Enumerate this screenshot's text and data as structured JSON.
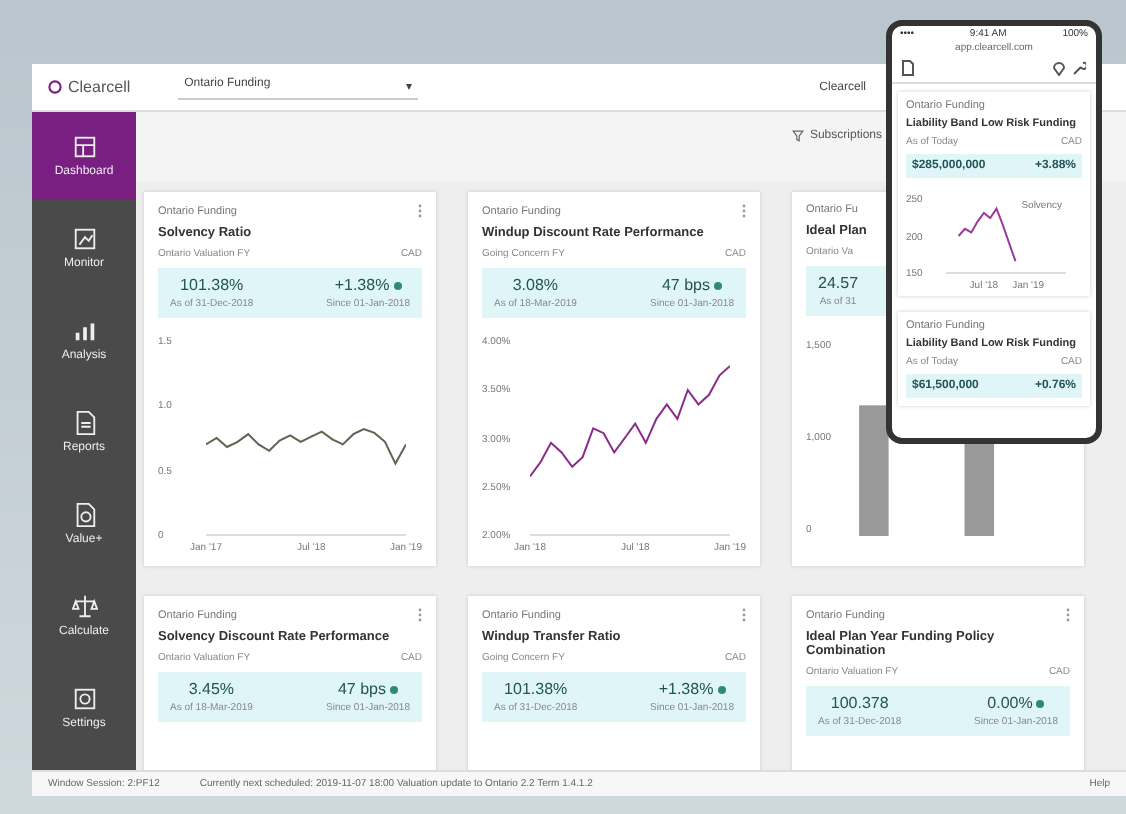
{
  "app": {
    "logo": "Clearcell",
    "plan_selector": "Ontario Funding",
    "caret": "▾",
    "account": "Clearcell"
  },
  "toolbar": {
    "subscriptions": "Subscriptions"
  },
  "sidebar": [
    {
      "label": "Dashboard",
      "selected": true
    },
    {
      "label": "Monitor",
      "selected": false
    },
    {
      "label": "Analysis",
      "selected": false
    },
    {
      "label": "Reports",
      "selected": false
    },
    {
      "label": "Value+",
      "selected": false
    },
    {
      "label": "Calculate",
      "selected": false
    },
    {
      "label": "Settings",
      "selected": false
    }
  ],
  "cards": [
    {
      "kind": "line",
      "category": "Ontario Funding",
      "title": "Solvency Ratio",
      "basis": "Ontario Valuation FY",
      "currency": "CAD",
      "metrics": [
        {
          "value": "101.38%",
          "caption": "As of 31-Dec-2018",
          "indicator": false
        },
        {
          "value": "+1.38%",
          "caption": "Since 01-Jan-2018",
          "indicator": true
        }
      ],
      "chart_data": {
        "type": "line",
        "categories": [
          "Jan '17",
          null,
          null,
          null,
          null,
          null,
          null,
          null,
          null,
          null,
          "Jul '18",
          null,
          null,
          null,
          null,
          null,
          null,
          null,
          null,
          "Jan '19"
        ],
        "ylim": [
          0,
          1.5
        ],
        "yticks": [
          {
            "value": 0,
            "label": "0"
          },
          {
            "value": 0.5,
            "label": "0.5"
          },
          {
            "value": 1,
            "label": "1.0"
          },
          {
            "value": 1.5,
            "label": "1.5"
          }
        ],
        "series": [
          {
            "color": "#5b6650",
            "values": [
              0.7,
              0.75,
              0.68,
              0.72,
              0.78,
              0.7,
              0.65,
              0.73,
              0.77,
              0.72,
              0.76,
              0.8,
              0.74,
              0.7,
              0.78,
              0.82,
              0.79,
              0.72,
              0.55,
              0.7
            ]
          }
        ]
      }
    },
    {
      "kind": "line",
      "category": "Ontario Funding",
      "title": "Windup Discount Rate Performance",
      "basis": "Going Concern FY",
      "currency": "CAD",
      "metrics": [
        {
          "value": "3.08%",
          "caption": "As of 18-Mar-2019",
          "indicator": false
        },
        {
          "value": "47 bps",
          "caption": "Since 01-Jan-2018",
          "indicator": true
        }
      ],
      "chart_data": {
        "type": "line",
        "categories": [
          "Jan '18",
          null,
          null,
          null,
          null,
          null,
          null,
          null,
          null,
          null,
          "Jul '18",
          null,
          null,
          null,
          null,
          null,
          null,
          null,
          null,
          "Jan '19"
        ],
        "ylim": [
          2,
          4
        ],
        "yticks": [
          {
            "value": 2,
            "label": "2.00%"
          },
          {
            "value": 2.5,
            "label": "2.50%"
          },
          {
            "value": 3,
            "label": "3.00%"
          },
          {
            "value": 3.5,
            "label": "3.50%"
          },
          {
            "value": 4,
            "label": "4.00%"
          }
        ],
        "series": [
          {
            "color": "#8a2b8a",
            "values": [
              2.6,
              2.75,
              2.95,
              2.85,
              2.7,
              2.8,
              3.1,
              3.05,
              2.85,
              3.0,
              3.15,
              2.95,
              3.2,
              3.35,
              3.2,
              3.5,
              3.35,
              3.45,
              3.65,
              3.75
            ]
          }
        ]
      }
    },
    {
      "kind": "bars",
      "category": "Ontario Fu",
      "title": "Ideal Plan",
      "basis": "Ontario Va",
      "metrics": [
        {
          "value": "24.57",
          "caption": "As of 31",
          "indicator": false
        }
      ],
      "y_ticks": [
        "1,500",
        "1,000",
        "0"
      ]
    },
    {
      "kind": "summary",
      "category": "Ontario Funding",
      "title": "Solvency Discount Rate Performance",
      "basis": "Ontario Valuation FY",
      "currency": "CAD",
      "metrics": [
        {
          "value": "3.45%",
          "caption": "As of 18-Mar-2019",
          "indicator": false
        },
        {
          "value": "47 bps",
          "caption": "Since 01-Jan-2018",
          "indicator": true
        }
      ]
    },
    {
      "kind": "summary",
      "category": "Ontario Funding",
      "title": "Windup Transfer Ratio",
      "basis": "Going Concern FY",
      "currency": "CAD",
      "metrics": [
        {
          "value": "101.38%",
          "caption": "As of 31-Dec-2018",
          "indicator": false
        },
        {
          "value": "+1.38%",
          "caption": "Since 01-Jan-2018",
          "indicator": true
        }
      ]
    },
    {
      "kind": "summary",
      "category": "Ontario Funding",
      "title": "Ideal Plan Year Funding Policy Combination",
      "basis": "Ontario Valuation FY",
      "currency": "CAD",
      "metrics": [
        {
          "value": "100.378",
          "caption": "As of 31-Dec-2018",
          "indicator": false
        },
        {
          "value": "0.00%",
          "caption": "Since 01-Jan-2018",
          "indicator": true
        }
      ]
    }
  ],
  "phone": {
    "carrier": "••••",
    "time": "9:41 AM",
    "battery": "100%",
    "url": "app.clearcell.com",
    "cards": [
      {
        "category": "Ontario Funding",
        "title": "Liability Band Low Risk Funding",
        "basis": "As of Today",
        "currency": "CAD",
        "metrics": [
          "$285,000,000",
          "+3.88%"
        ],
        "annotation": "Solvency",
        "chart_data": {
          "type": "line",
          "categories": [
            null,
            null,
            null,
            null,
            null,
            null,
            "Jul '18",
            null,
            null,
            null,
            null,
            null,
            null,
            "Jan '19",
            null,
            null,
            null,
            null,
            null,
            null
          ],
          "ylim": [
            150,
            250
          ],
          "yticks": [
            {
              "value": 150,
              "label": "150"
            },
            {
              "value": 200,
              "label": "200"
            },
            {
              "value": 250,
              "label": "250"
            }
          ],
          "series": [
            {
              "color": "#9a3a9a",
              "values": [
                null,
                null,
                200,
                210,
                205,
                220,
                232,
                225,
                238,
                215,
                190,
                165,
                null,
                null,
                null,
                null,
                null,
                null,
                null,
                null
              ]
            }
          ]
        }
      },
      {
        "category": "Ontario Funding",
        "title": "Liability Band Low Risk Funding",
        "basis": "As of Today",
        "currency": "CAD",
        "metrics": [
          "$61,500,000",
          "+0.76%"
        ]
      }
    ]
  },
  "status_bar": {
    "left": "Window Session: 2:PF12",
    "center": "Currently next scheduled: 2019-11-07 18:00 Valuation update to Ontario 2.2 Term 1.4.1.2",
    "right": "Help"
  }
}
